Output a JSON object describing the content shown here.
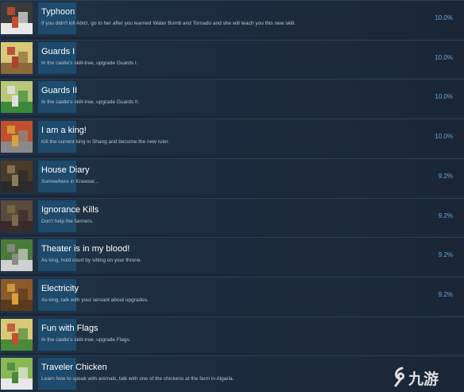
{
  "achievements": [
    {
      "title": "Typhoon",
      "description": "If you didn't kill Abriz, go to her after you learned Water Bomb and Tornado and she will teach you this new skill.",
      "percent": "10.0%",
      "icon": "white-haired-character-icon",
      "colors": [
        "#3a3a3a",
        "#e8e8e8",
        "#c05030"
      ]
    },
    {
      "title": "Guards I",
      "description": "In the castle's skill-tree, upgrade Guards I.",
      "percent": "10.0%",
      "icon": "guard-tile-icon",
      "colors": [
        "#d8c878",
        "#8a6a3a",
        "#b04030"
      ]
    },
    {
      "title": "Guards II",
      "description": "In the castle's skill-tree, upgrade Guards II.",
      "percent": "10.0%",
      "icon": "guard-field-icon",
      "colors": [
        "#b8c878",
        "#3a8a3a",
        "#e0e0e0"
      ]
    },
    {
      "title": "I am a king!",
      "description": "Kill the current king in Shang and become the new ruler.",
      "percent": "10.0%",
      "icon": "throne-icon",
      "colors": [
        "#c05030",
        "#8a8a8a",
        "#d8a040"
      ]
    },
    {
      "title": "House Diary",
      "description": "Somewhere in Krawser...",
      "percent": "9.2%",
      "icon": "house-interior-icon",
      "colors": [
        "#4a3a2a",
        "#2a2a2a",
        "#8a7a5a"
      ]
    },
    {
      "title": "Ignorance Kills",
      "description": "Don't help the farmers.",
      "percent": "9.2%",
      "icon": "farm-icon",
      "colors": [
        "#5a4a3a",
        "#3a2a2a",
        "#7a6a4a"
      ]
    },
    {
      "title": "Theater is in my blood!",
      "description": "As king, hold court by sitting on your throne.",
      "percent": "9.2%",
      "icon": "court-icon",
      "colors": [
        "#4a7a3a",
        "#d0d0d0",
        "#8a8a8a"
      ]
    },
    {
      "title": "Electricity",
      "description": "As king, talk with your servant about upgrades.",
      "percent": "9.2%",
      "icon": "bookshelf-icon",
      "colors": [
        "#8a5a2a",
        "#5a3a1a",
        "#d8a040"
      ]
    },
    {
      "title": "Fun with Flags",
      "description": "In the castle's skill-tree, upgrade Flags.",
      "percent": "",
      "icon": "flag-icon",
      "colors": [
        "#d8c878",
        "#4a8a3a",
        "#c05030"
      ]
    },
    {
      "title": "Traveler Chicken",
      "description": "Learn how to speak with animals, talk with one of the chickens at the farm in Algaria.",
      "percent": "",
      "icon": "chicken-icon",
      "colors": [
        "#8ab858",
        "#e8e8e8",
        "#4a8a3a"
      ]
    }
  ],
  "watermark": {
    "text": "九游",
    "icon": "swirl-logo-icon"
  }
}
